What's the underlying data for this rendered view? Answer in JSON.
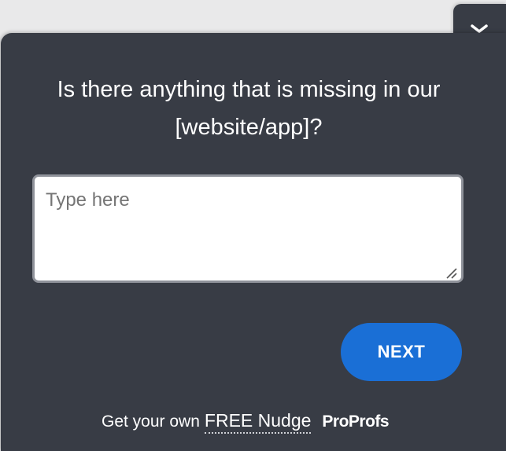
{
  "question": {
    "text": "Is there anything that is missing in our [website/app]?"
  },
  "answer": {
    "value": "",
    "placeholder": "Type here"
  },
  "actions": {
    "next_label": "NEXT"
  },
  "footer": {
    "prefix": "Get your own",
    "link_text": "FREE Nudge",
    "brand": "ProProfs"
  },
  "icons": {
    "collapse": "chevron-down-icon",
    "resize": "resize-grip-icon"
  },
  "colors": {
    "panel_bg": "#383c45",
    "accent": "#1a6fd6",
    "page_bg": "#e9e9ea"
  }
}
